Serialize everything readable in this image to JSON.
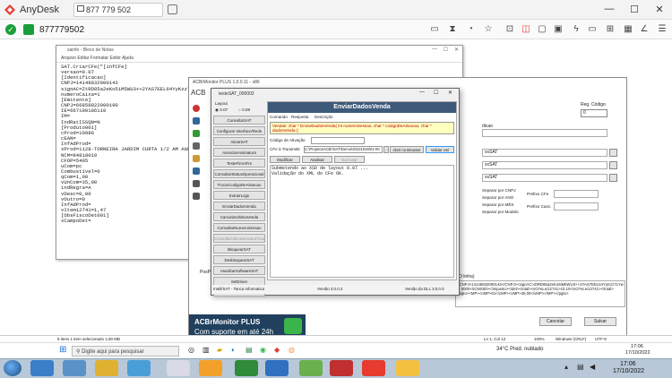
{
  "app": {
    "name": "AnyDesk",
    "tab_label": "877 779 502",
    "address": "877779502"
  },
  "notepad": {
    "title": "sainfe - Bloco de Notas",
    "menu": "Arquivo  Editar  Formatar  Exibir  Ajuda",
    "content": "SAT.CriarCFe(\"[infCFe]\nversao=0.07\n[Identificacao]\nCNPJ=14148832000143\nsignAC=ZtRD85a2eKo5iM5WU3++2YAS7EEL64YyKzz7LYw\nnumeroCaixa=1\n[Emitente]\nCNPJ=66858822000190\nIE=667190186110\nIM=\nIndRatISSQN=N\n[Produto001]\ncProd=10986\ncEAN=\nInfAdProd=\nxProd=1128-TORNEIRA JARDIM CURTA 1/2 AM AGUAI\nNCM=84818019\nCFOP=5405\nuCom=pc\nCombustivel=0\nqCom=1,00\nvUnCom=35,00\nindRegra=A\nvDesc=0,00\nvOutro=0\nInfAdProd=\nvItem12741=1,47\n[ObsFiscoDet001]\nxCampoDet="
  },
  "acbr_main": {
    "title": "ACBrMonitor PLUS 1.0.0.11 - x86",
    "banner_line1": "ACBrMonitor PLUS",
    "banner_line2": "Com suporte em até 24h",
    "right": {
      "reg_label": "Reg. Código",
      "reg_value": "0",
      "fields": [
        "xxSAT",
        "xxSAT",
        "xxSAT"
      ],
      "labels": [
        "Separar por CNPJ",
        "Separar por ANO",
        "Separar por MÊS",
        "Separar por Modelo"
      ],
      "prefix_labels": [
        "Prefixo CFe",
        "Prefixo Canc."
      ],
      "section": "dicao"
    },
    "log_section": "O linha)",
    "log_text": "<CNPJ>14148832000143</CNPJ><signAC>ZtRD85a2eKo5iM5WU3++2YAS7EEL64YyKzz7LYw ... 0000</ICMS00></imposto></det><total><vCFeLei12741>10,10</vCFeLei12741></total><pgto><MP><cMP>01</cMP><vMP>30,00</vMP></MP></pgto>",
    "cancel_label": "Cancelar",
    "save_label": "Salvar",
    "sidebar_label": "PosPrinter"
  },
  "satwin": {
    "title": "testeSAT_000002",
    "layout_label": "Layout",
    "layout_options": [
      "0.07",
      "0.08"
    ],
    "buttons": [
      "ConsultarSAT",
      "Configurar Interface/Rede",
      "AtivarSAT",
      "AssociarAssinatura",
      "TesteFimAFim",
      "ConsultarStatusOperacional",
      "TrocarCodigoDeAtivacao",
      "ExtrairLogs",
      "EnviarDadosVenda",
      "CancelarUltimaVenda",
      "ConsultarNumeroSessao",
      "ConsultarUltimaSessaoFiscal",
      "BloquearSAT",
      "DesbloquearSAT",
      "AtualizarSoftwareSAT",
      "SetDriver",
      "Sair"
    ],
    "panel_header": "EnviarDadosVenda",
    "tabs": [
      "Comando",
      "Resposta",
      "Descrição"
    ],
    "notice": "Vendas: char * EnviarDadosVenda( int numeroSessao, char * codigoDeAtivacao, char * dadosVenda );",
    "codigo_label": "Código de Ativação",
    "cfe_label": "CFe à Transmitir",
    "cfe_value": "C:\\ProjetosACBr\\SAT\\Demo\\20221016\\01-00",
    "browse_label": "Abrir no Browser",
    "validate_label": "Validar xml",
    "actions": [
      "Modificar",
      "Analisar",
      "Executar"
    ],
    "log": "Submetendo ao XSD de layout 0.07 ...\nValidação do XML do CFe OK.",
    "footer_left": "Intell/SAT - Tanca Informatica",
    "footer_mid": "Versão 3.0.0.2",
    "footer_right": "Versão da DLL 3.0.0.0"
  },
  "remote_status": {
    "left": "8 itens    1 item selecionado 1,90 MB",
    "mid": "Ln 1, Col 12",
    "zoom": "100%",
    "eol": "Windows (CRLF)",
    "enc": "UTF-8"
  },
  "remote_taskbar": {
    "search_placeholder": "Digite aqui para pesquisar",
    "weather": "34°C  Pred. nublado",
    "time": "17:06",
    "date": "17/10/2022"
  },
  "local_taskbar": {
    "time": "17:06",
    "date": "17/10/2022"
  },
  "colors": {
    "anydesk_red": "#e63b2e",
    "ok_green": "#1a9e3a",
    "banner_blue": "#20405e",
    "panel_header": "#3d5a7a"
  }
}
